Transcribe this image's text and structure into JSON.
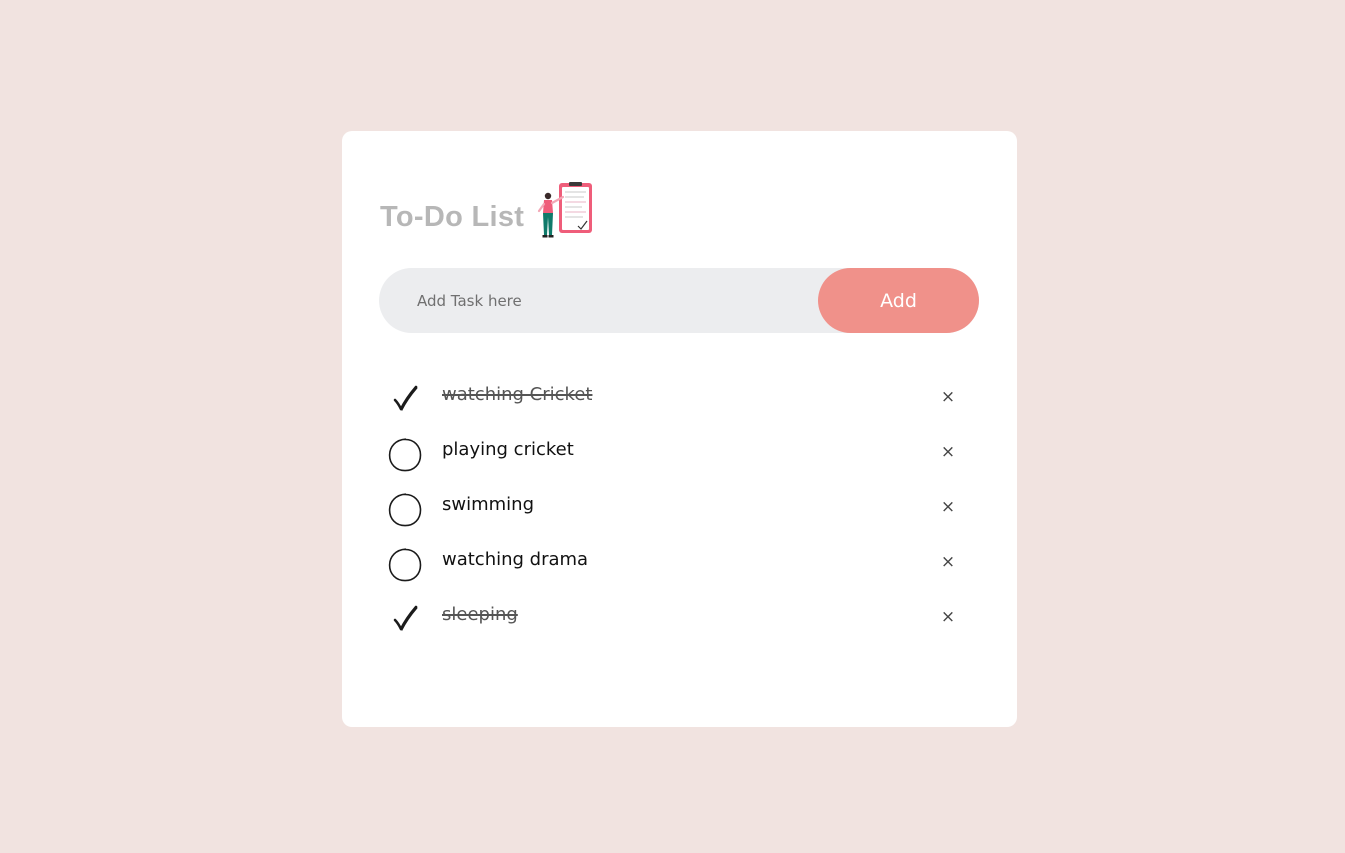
{
  "app": {
    "title": "To-Do List",
    "title_icon": "clipboard-checklist-illustration"
  },
  "input": {
    "placeholder": "Add Task here",
    "value": ""
  },
  "add_button": {
    "label": "Add"
  },
  "tasks": [
    {
      "text": "watching Cricket",
      "done": true
    },
    {
      "text": "playing cricket",
      "done": false
    },
    {
      "text": "swimming",
      "done": false
    },
    {
      "text": "watching drama",
      "done": false
    },
    {
      "text": "sleeping",
      "done": true
    }
  ],
  "delete_symbol": "×",
  "icons": {
    "done": "check-icon",
    "pending": "circle-icon",
    "delete": "close-icon"
  },
  "colors": {
    "background": "#f1e3e0",
    "card": "#ffffff",
    "input_bg": "#ecedef",
    "accent": "#f0918a",
    "title": "#b7b7b7"
  }
}
